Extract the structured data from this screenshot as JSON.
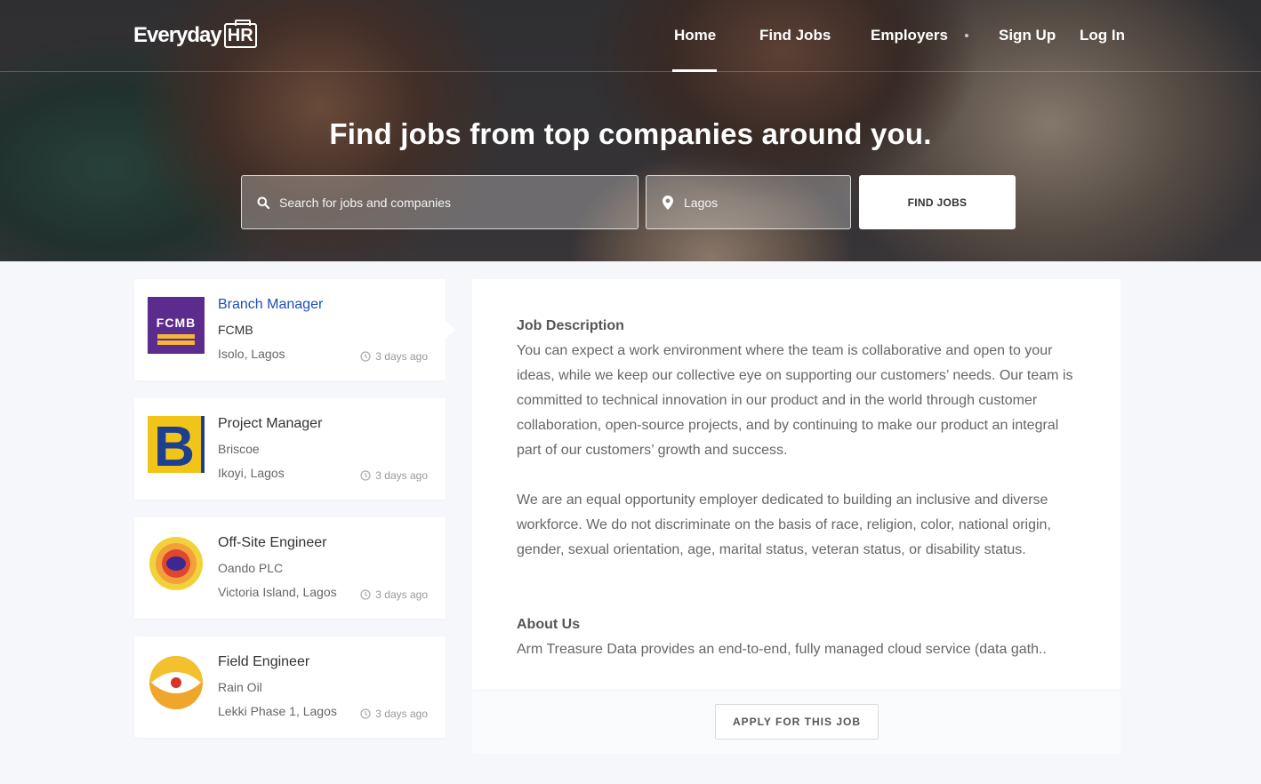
{
  "header": {
    "logo_text": "Everyday",
    "logo_badge": "HR",
    "nav": [
      "Home",
      "Find Jobs",
      "Employers",
      "Sign Up",
      "Log In"
    ],
    "active_nav": "Home"
  },
  "hero": {
    "title": "Find jobs from top companies around you.",
    "search_placeholder": "Search for jobs and companies",
    "location_placeholder": "Lagos",
    "find_button": "FIND JOBS"
  },
  "jobs": [
    {
      "title": "Branch Manager",
      "company": "FCMB",
      "location": "Isolo, Lagos",
      "posted": "3 days ago",
      "logo_text": "FCMB",
      "active": true
    },
    {
      "title": "Project Manager",
      "company": "Briscoe",
      "location": "Ikoyi, Lagos",
      "posted": "3 days ago",
      "logo_text": "B"
    },
    {
      "title": "Off-Site Engineer",
      "company": "Oando PLC",
      "location": "Victoria Island, Lagos",
      "posted": "3 days ago"
    },
    {
      "title": "Field Engineer",
      "company": "Rain Oil",
      "location": "Lekki Phase 1, Lagos",
      "posted": "3 days ago"
    }
  ],
  "detail": {
    "description_heading": "Job Description",
    "description_p1": "You can expect a work environment where the team is collaborative and open to your ideas, while we keep our collective eye on supporting our customers’ needs. Our team is committed to technical innovation in our product and in the world through customer collaboration, open-source projects, and by continuing to make our product an integral part of our customers’ growth and success.",
    "description_p2": "We are an equal opportunity employer dedicated to building an inclusive and diverse workforce. We do not discriminate on the basis of race, religion, color, national origin, gender, sexual orientation, age, marital status, veteran status, or disability status.",
    "about_heading": "About Us",
    "about_text": "Arm Treasure Data provides an end-to-end, fully managed cloud service (data gath..",
    "apply_button": "APPLY FOR THIS JOB"
  },
  "colors": {
    "accent_link": "#1f4fb3",
    "fcmb_purple": "#5b2c8e",
    "briscoe_yellow": "#f0c419",
    "briscoe_blue": "#1d3f8f"
  },
  "icons": [
    "search-icon",
    "location-pin-icon",
    "clock-icon"
  ]
}
